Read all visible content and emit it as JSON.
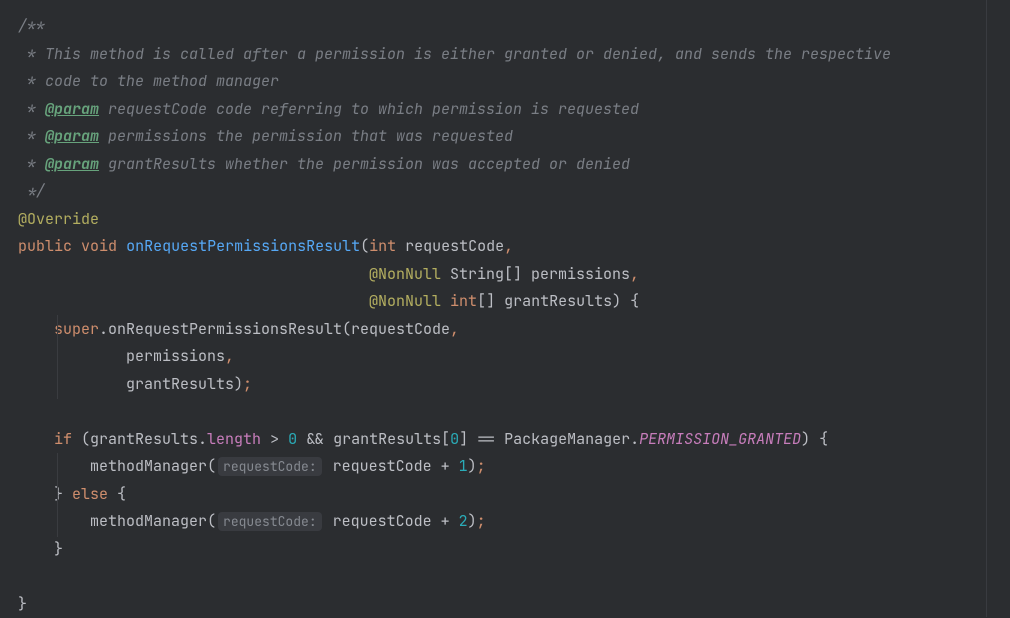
{
  "code": {
    "c1": "/**",
    "c2": " * This method is called after a permission is either granted or denied, and sends the respective",
    "c3": " * code to the method manager",
    "c4a": " * ",
    "tag": "@param",
    "c4b": " requestCode",
    "c4c": " code referring to which permission is requested",
    "c5b": " permissions",
    "c5c": " the permission that was requested",
    "c6b": " grantResults",
    "c6c": " whether the permission was accepted or denied",
    "c7": " */",
    "ann_override": "@Override",
    "kw_public": "public",
    "kw_void": "void",
    "fname": "onRequestPermissionsResult",
    "p_int": "int",
    "p_requestCode": " requestCode",
    "comma": ",",
    "ann_nonnull": "@NonNull",
    "p_stringarr": " String[] permissions",
    "p_intarr": "[] grantResults) {",
    "kw_super": "super",
    "super_call": ".onRequestPermissionsResult(requestCode",
    "l_permissions": "            permissions",
    "l_grantResults": "            grantResults)",
    "semi": ";",
    "kw_if": "if",
    "if_open": " (grantResults.",
    "field_length": "length",
    "gt": " > ",
    "zero": "0",
    "and_gr": " && grantResults[",
    "close_eq": "] == PackageManager.",
    "perm_granted": "PERMISSION_GRANTED",
    "close_if": ") {",
    "mm_open": "        methodManager(",
    "hint": "requestCode:",
    "mm_arg": " requestCode + ",
    "one": "1",
    "two": "2",
    "close_call": ")",
    "brace_close_else": "    } ",
    "kw_else": "else",
    "else_open": " {",
    "brace_close": "    }",
    "brace_close2": "}"
  }
}
